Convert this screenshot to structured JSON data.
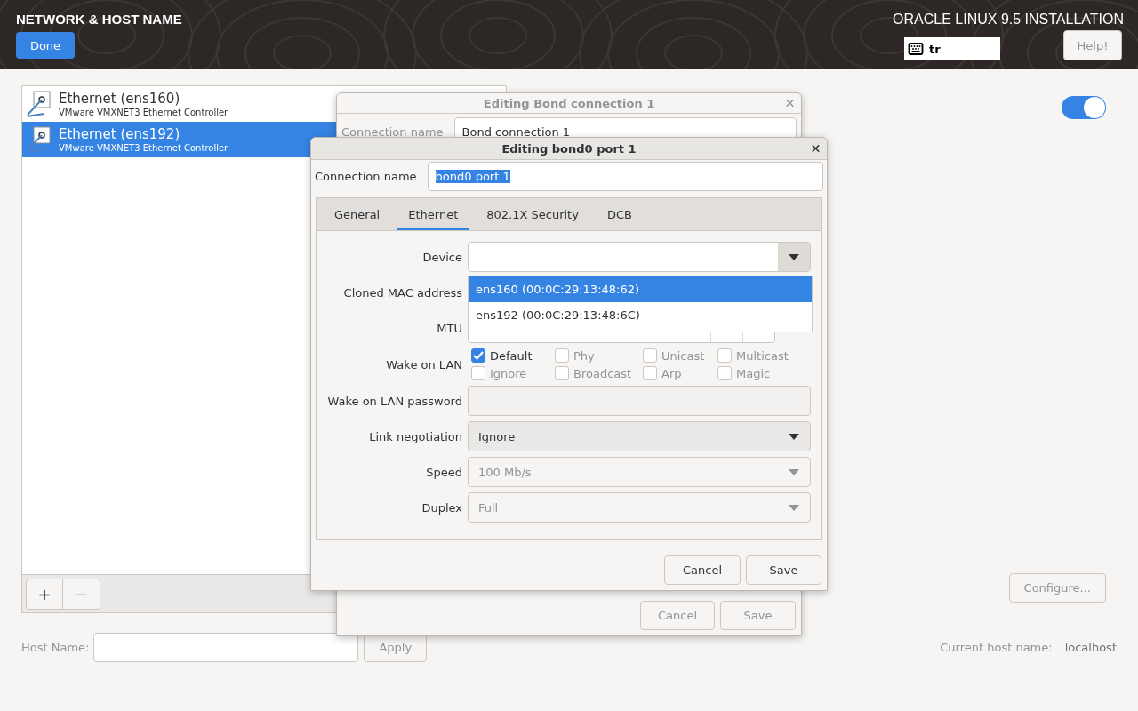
{
  "header": {
    "title": "NETWORK & HOST NAME",
    "done_button": "Done",
    "product": "ORACLE LINUX 9.5 INSTALLATION",
    "keyboard_layout": "tr",
    "help_button": "Help!"
  },
  "connections": [
    {
      "name": "Ethernet (ens160)",
      "description": "VMware VMXNET3 Ethernet Controller",
      "selected": false
    },
    {
      "name": "Ethernet (ens192)",
      "description": "VMware VMXNET3 Ethernet Controller",
      "selected": true
    }
  ],
  "list_buttons": [
    {
      "label": "+",
      "disabled": false
    },
    {
      "label": "−",
      "disabled": true
    }
  ],
  "toggle": {
    "on": true
  },
  "configure_button": {
    "label": "Configure...",
    "disabled": true
  },
  "host_name": {
    "label": "Host Name:",
    "apply_button": "Apply"
  },
  "current_host_name": {
    "label": "Current host name:",
    "value": "localhost"
  },
  "bond_dialog": {
    "title": "Editing Bond connection 1",
    "connection_name_label": "Connection name",
    "connection_name": "Bond connection 1",
    "buttons": [
      "Cancel",
      "Save"
    ]
  },
  "port_dialog": {
    "title": "Editing bond0 port 1",
    "connection_name_label": "Connection name",
    "connection_name": "bond0 port 1",
    "text_selected": true,
    "tabs": [
      {
        "label": "General",
        "selected": false
      },
      {
        "label": "Ethernet",
        "selected": true
      },
      {
        "label": "802.1X Security",
        "selected": false
      },
      {
        "label": "DCB",
        "selected": false
      }
    ],
    "rows": [
      {
        "kind": "combo",
        "label": "Device",
        "disabled": false
      },
      {
        "kind": "covered",
        "label": "Cloned MAC address"
      },
      {
        "kind": "spin",
        "label": "MTU"
      },
      {
        "kind": "checks",
        "label": "Wake on LAN",
        "options": [
          {
            "label": "Default",
            "checked": true,
            "disabled": false
          },
          {
            "label": "Phy",
            "checked": false,
            "disabled": true
          },
          {
            "label": "Unicast",
            "checked": false,
            "disabled": true
          },
          {
            "label": "Multicast",
            "checked": false,
            "disabled": true
          },
          {
            "label": "Ignore",
            "checked": false,
            "disabled": true
          },
          {
            "label": "Broadcast",
            "checked": false,
            "disabled": true
          },
          {
            "label": "Arp",
            "checked": false,
            "disabled": true
          },
          {
            "label": "Magic",
            "checked": false,
            "disabled": true
          }
        ]
      },
      {
        "kind": "entry",
        "label": "Wake on LAN password",
        "disabled": true
      },
      {
        "kind": "combo",
        "label": "Link negotiation",
        "value": "Ignore",
        "disabled": false
      },
      {
        "kind": "combo",
        "label": "Speed",
        "value": "100 Mb/s",
        "disabled": true
      },
      {
        "kind": "combo",
        "label": "Duplex",
        "value": "Full",
        "disabled": true
      }
    ],
    "device_options": [
      {
        "label": "ens160 (00:0C:29:13:48:62)",
        "selected": true
      },
      {
        "label": "ens192 (00:0C:29:13:48:6C)",
        "selected": false
      }
    ],
    "buttons": [
      "Cancel",
      "Save"
    ]
  }
}
